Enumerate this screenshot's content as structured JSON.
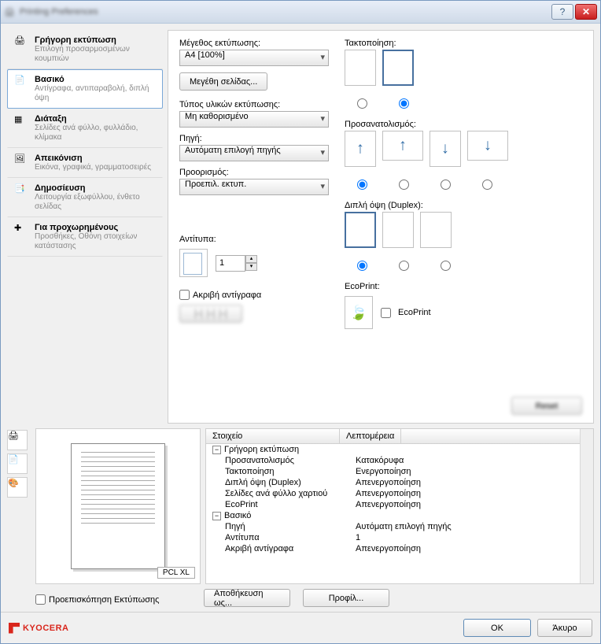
{
  "window": {
    "title": "Printing Preferences"
  },
  "sidebar": {
    "items": [
      {
        "title": "Γρήγορη εκτύπωση",
        "desc": "Επιλογή προσαρμοσμένων κουμπιών"
      },
      {
        "title": "Βασικό",
        "desc": "Αντίγραφα, αντιπαραβολή, διπλή όψη"
      },
      {
        "title": "Διάταξη",
        "desc": "Σελίδες ανά φύλλο, φυλλάδιο, κλίμακα"
      },
      {
        "title": "Απεικόνιση",
        "desc": "Εικόνα, γραφικά, γραμματοσειρές"
      },
      {
        "title": "Δημοσίευση",
        "desc": "Λειτουργία εξωφύλλου, ένθετο σελίδας"
      },
      {
        "title": "Για προχωρημένους",
        "desc": "Προσθήκες, Οθόνη στοιχείων κατάστασης"
      }
    ]
  },
  "basic": {
    "printSizeLabel": "Μέγεθος εκτύπωσης:",
    "printSizeValue": "A4  [100%]",
    "pageSizesBtn": "Μεγέθη σελίδας...",
    "mediaTypeLabel": "Τύπος υλικών εκτύπωσης:",
    "mediaTypeValue": "Μη καθορισμένο",
    "sourceLabel": "Πηγή:",
    "sourceValue": "Αυτόματη επιλογή πηγής",
    "destLabel": "Προορισμός:",
    "destValue": "Προεπιλ. εκτυπ.",
    "copiesLabel": "Αντίτυπα:",
    "copiesValue": "1",
    "exactCopiesLabel": "Ακριβή αντίγραφα"
  },
  "right": {
    "collateLabel": "Τακτοποίηση:",
    "orientationLabel": "Προσανατολισμός:",
    "duplexLabel": "Διπλή όψη (Duplex):",
    "ecoLabel": "EcoPrint:",
    "ecoCheckbox": "EcoPrint"
  },
  "preview": {
    "pclTag": "PCL XL",
    "previewPrintLabel": "Προεπισκόπηση Εκτύπωσης"
  },
  "details": {
    "col1": "Στοιχείο",
    "col2": "Λεπτομέρεια",
    "rows": [
      {
        "group": true,
        "c1": "Γρήγορη εκτύπωση",
        "c2": ""
      },
      {
        "c1": "Προσανατολισμός",
        "c2": "Κατακόρυφα"
      },
      {
        "c1": "Τακτοποίηση",
        "c2": "Ενεργοποίηση"
      },
      {
        "c1": "Διπλή όψη (Duplex)",
        "c2": "Απενεργοποίηση"
      },
      {
        "c1": "Σελίδες ανά φύλλο χαρτιού",
        "c2": "Απενεργοποίηση"
      },
      {
        "c1": "EcoPrint",
        "c2": "Απενεργοποίηση"
      },
      {
        "group": true,
        "c1": "Βασικό",
        "c2": ""
      },
      {
        "c1": "Πηγή",
        "c2": "Αυτόματη επιλογή πηγής"
      },
      {
        "c1": "Αντίτυπα",
        "c2": "1"
      },
      {
        "c1": "Ακριβή αντίγραφα",
        "c2": "Απενεργοποίηση"
      }
    ]
  },
  "buttons": {
    "saveAs": "Αποθήκευση ως...",
    "profile": "Προφίλ...",
    "ok": "OK",
    "cancel": "Άκυρο"
  },
  "brand": "KYOCERA"
}
